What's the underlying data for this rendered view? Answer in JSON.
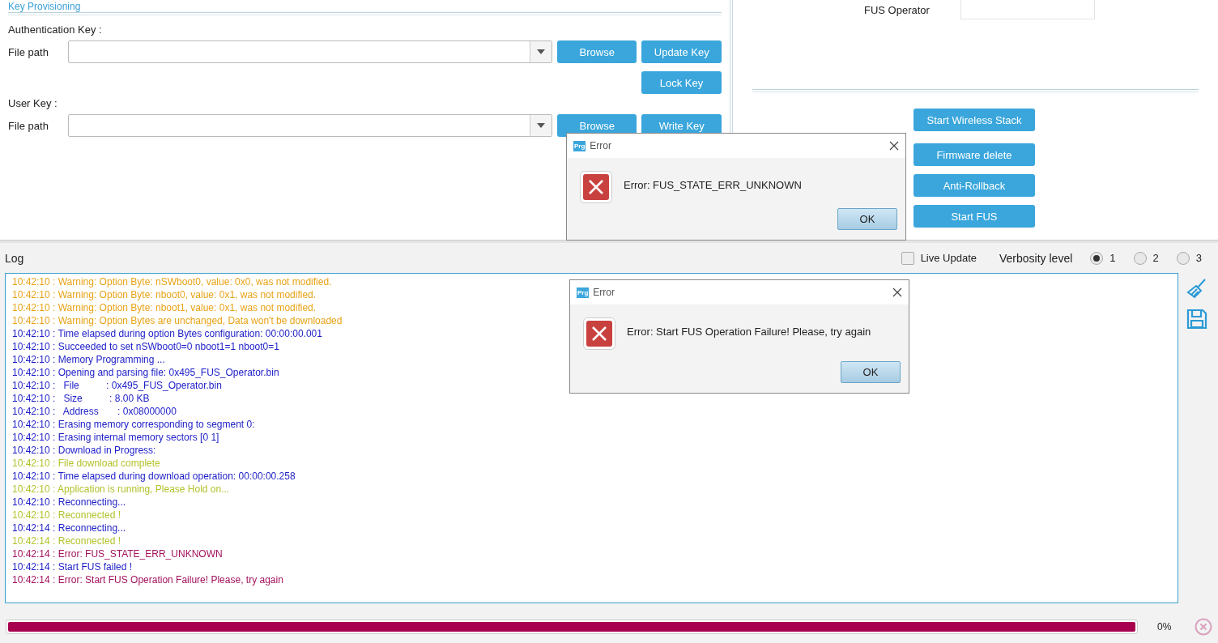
{
  "key_provisioning": {
    "title": "Key Provisioning",
    "sections": [
      {
        "heading": "Authentication Key :",
        "file_label": "File path",
        "buttons": [
          "Browse",
          "Update Key"
        ],
        "extra_buttons": [
          "Lock Key"
        ]
      },
      {
        "heading": "User Key :",
        "file_label": "File path",
        "buttons": [
          "Browse",
          "Write Key"
        ]
      }
    ]
  },
  "fus_panel": {
    "operator_label": "FUS Operator",
    "buttons": [
      "Start Wireless Stack",
      "Firmware delete",
      "Anti-Rollback",
      "Start FUS"
    ]
  },
  "log": {
    "title": "Log",
    "live_update": {
      "label": "Live Update",
      "checked": false
    },
    "verbosity": {
      "label": "Verbosity level",
      "options": [
        {
          "label": "1",
          "selected": true
        },
        {
          "label": "2",
          "selected": false
        },
        {
          "label": "3",
          "selected": false
        }
      ]
    },
    "lines": [
      {
        "kind": "warning",
        "text": "10:42:10 : Warning: Option Byte: nSWboot0, value: 0x0, was not modified."
      },
      {
        "kind": "warning",
        "text": "10:42:10 : Warning: Option Byte: nboot0, value: 0x1, was not modified."
      },
      {
        "kind": "warning",
        "text": "10:42:10 : Warning: Option Byte: nboot1, value: 0x1, was not modified."
      },
      {
        "kind": "warning",
        "text": "10:42:10 : Warning: Option Bytes are unchanged, Data won't be downloaded"
      },
      {
        "kind": "info",
        "text": "10:42:10 : Time elapsed during option Bytes configuration: 00:00:00.001"
      },
      {
        "kind": "info",
        "text": "10:42:10 : Succeeded to set nSWboot0=0 nboot1=1 nboot0=1"
      },
      {
        "kind": "info",
        "text": "10:42:10 : Memory Programming ..."
      },
      {
        "kind": "info",
        "text": "10:42:10 : Opening and parsing file: 0x495_FUS_Operator.bin"
      },
      {
        "kind": "info",
        "text": "10:42:10 :   File          : 0x495_FUS_Operator.bin"
      },
      {
        "kind": "info",
        "text": "10:42:10 :   Size          : 8.00 KB"
      },
      {
        "kind": "info",
        "text": "10:42:10 :   Address       : 0x08000000"
      },
      {
        "kind": "info",
        "text": "10:42:10 : Erasing memory corresponding to segment 0:"
      },
      {
        "kind": "info",
        "text": "10:42:10 : Erasing internal memory sectors [0 1]"
      },
      {
        "kind": "info",
        "text": "10:42:10 : Download in Progress:"
      },
      {
        "kind": "success",
        "text": "10:42:10 : File download complete"
      },
      {
        "kind": "info",
        "text": "10:42:10 : Time elapsed during download operation: 00:00:00.258"
      },
      {
        "kind": "success",
        "text": "10:42:10 : Application is running, Please Hold on..."
      },
      {
        "kind": "info",
        "text": "10:42:10 : Reconnecting..."
      },
      {
        "kind": "success",
        "text": "10:42:10 : Reconnected !"
      },
      {
        "kind": "info",
        "text": "10:42:14 : Reconnecting..."
      },
      {
        "kind": "success",
        "text": "10:42:14 : Reconnected !"
      },
      {
        "kind": "error",
        "text": "10:42:14 : Error: FUS_STATE_ERR_UNKNOWN"
      },
      {
        "kind": "info",
        "text": "10:42:14 : Start FUS failed !"
      },
      {
        "kind": "error",
        "text": "10:42:14 : Error: Start FUS Operation Failure! Please, try again"
      }
    ]
  },
  "progress": {
    "level": 1,
    "reading": "0%"
  },
  "dialogs": [
    {
      "badge": "Prg",
      "title": "Error",
      "message": "Error: FUS_STATE_ERR_UNKNOWN",
      "button": "OK"
    },
    {
      "badge": "Prg",
      "title": "Error",
      "message": "Error: Start FUS Operation Failure! Please, try again",
      "button": "OK"
    }
  ]
}
